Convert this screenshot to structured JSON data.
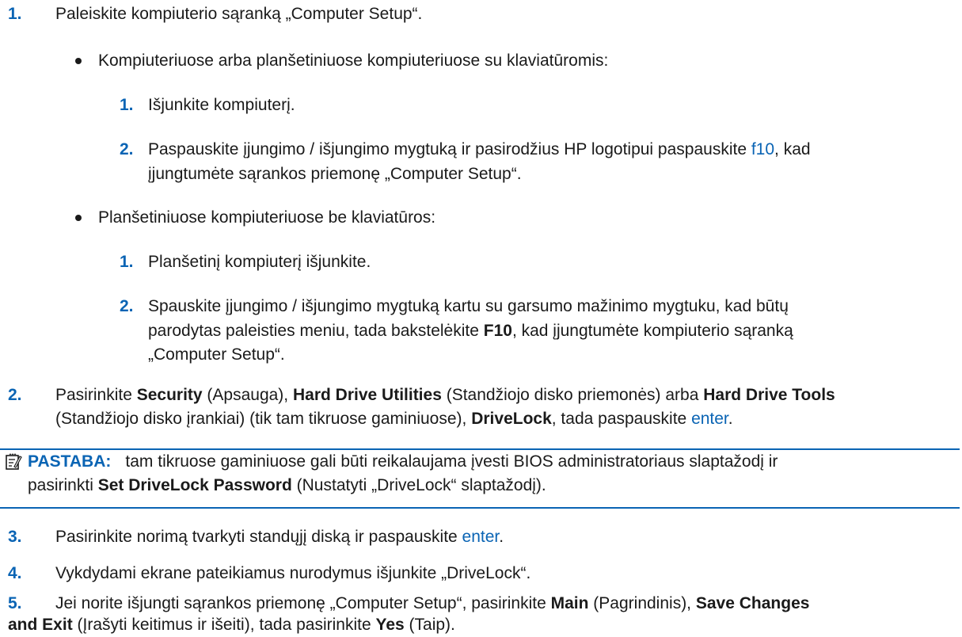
{
  "steps": [
    {
      "num": "1.",
      "text": "Paleiskite kompiuterio sąranką „Computer Setup“.",
      "bullets": [
        {
          "text": "Kompiuteriuose arba planšetiniuose kompiuteriuose su klaviatūromis:",
          "substeps": [
            {
              "num": "1.",
              "text": "Išjunkite kompiuterį."
            },
            {
              "num": "2.",
              "line1_a": "Paspauskite įjungimo / išjungimo mygtuką ir pasirodžius HP logotipui paspauskite ",
              "line1_key": "f10",
              "line1_b": ", kad",
              "line2": "įjungtumėte sąrankos priemonę „Computer Setup“."
            }
          ]
        },
        {
          "text": "Planšetiniuose kompiuteriuose be klaviatūros:",
          "substeps": [
            {
              "num": "1.",
              "text": "Planšetinį kompiuterį išjunkite."
            },
            {
              "num": "2.",
              "line1": "Spauskite įjungimo / išjungimo mygtuką kartu su garsumo mažinimo mygtuku, kad būtų",
              "line2_a": "parodytas paleisties meniu, tada bakstelėkite ",
              "line2_bold": "F10",
              "line2_b": ", kad įjungtumėte kompiuterio sąranką",
              "line3": "„Computer Setup“."
            }
          ]
        }
      ]
    },
    {
      "num": "2.",
      "line1_t1": "Pasirinkite ",
      "line1_b1": "Security",
      "line1_t2": " (Apsauga), ",
      "line1_b2": "Hard Drive Utilities",
      "line1_t3": " (Standžiojo disko priemonės) arba ",
      "line1_b3": "Hard Drive Tools",
      "line2_t1": "(Standžiojo disko įrankiai) (tik tam tikruose gaminiuose), ",
      "line2_b1": "DriveLock",
      "line2_t2": ", tada paspauskite ",
      "line2_key": "enter",
      "line2_t3": "."
    },
    {
      "num": "3.",
      "text": "Pasirinkite norimą tvarkyti standųjį diską ir paspauskite ",
      "key": "enter",
      "end": "."
    },
    {
      "num": "4.",
      "text": "Vykdydami ekrane pateikiamus nurodymus išjunkite „DriveLock“."
    },
    {
      "num": "5.",
      "line1_t1": "Jei norite išjungti sąrankos priemonę „Computer Setup“, pasirinkite ",
      "line1_b1": "Main",
      "line1_t2": " (Pagrindinis), ",
      "line1_b2": "Save Changes",
      "line2_b1": "and Exit",
      "line2_t1": " (Įrašyti keitimus ir išeiti), tada pasirinkite ",
      "line2_b2": "Yes",
      "line2_t2": " (Taip)."
    }
  ],
  "note": {
    "icon": "note-icon",
    "label": "PASTABA:",
    "line1": "tam tikruose gaminiuose gali būti reikalaujama įvesti BIOS administratoriaus slaptažodį ir",
    "line2_a": "pasirinkti ",
    "line2_bold": "Set DriveLock Password",
    "line2_b": " (Nustatyti „DriveLock“ slaptažodį)."
  },
  "colors": {
    "accent": "#0a64b4",
    "text": "#1a1a1a"
  }
}
